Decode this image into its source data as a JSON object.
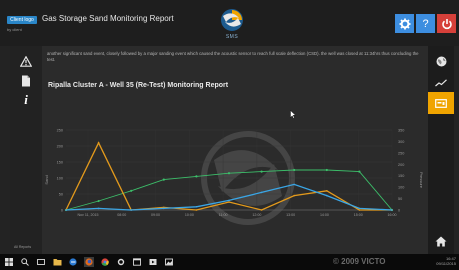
{
  "header": {
    "badge": "Client logo",
    "badge_sub": "by client",
    "title": "Gas Storage Sand Monitoring Report",
    "logo_text": "SMS",
    "help_label": "?"
  },
  "report": {
    "notes": "another significant sand event, closely followed by a major sanding event which caused the acoustic sensor to reach full scale deflection (CSD). the well was closed at 11:34hrs thus concluding the test.",
    "title": "Ripalla Cluster A - Well 35 (Re-Test) Monitoring Report"
  },
  "sidebar_left": {
    "info_label": "i",
    "footer": "All Reports"
  },
  "icons": [
    "warning-icon",
    "document-icon",
    "info-icon",
    "globe-icon",
    "trend-icon",
    "monitor-icon",
    "home-icon",
    "gear-icon",
    "help-icon",
    "power-icon"
  ],
  "colors": {
    "accent": "#3d8ee0",
    "power": "#d6403a",
    "active_tab": "#f0a400",
    "series_orange": "#e39a1c",
    "series_blue": "#3aa6e6",
    "series_green": "#3cbf6a"
  },
  "chart_data": {
    "type": "line",
    "ylabel": "Sand",
    "y2label": "Pressure",
    "yticks": [
      "250",
      "200",
      "150",
      "100",
      "50",
      "0"
    ],
    "y2ticks": [
      "350",
      "300",
      "250",
      "200",
      "150",
      "100",
      "50",
      "0"
    ],
    "xticks": [
      "Nov 11, 2015",
      "08:00",
      "09:00",
      "10:00",
      "11:00",
      "12:00",
      "13:00",
      "14:00",
      "15:00",
      "16:00"
    ],
    "grid": true,
    "series": [
      {
        "color": "#3cbf6a",
        "values": [
          0,
          28,
          60,
          95,
          105,
          115,
          120,
          125,
          125,
          120,
          0
        ]
      },
      {
        "color": "#e39a1c",
        "values": [
          0,
          210,
          0,
          8,
          0,
          25,
          0,
          45,
          60,
          0,
          0
        ]
      },
      {
        "color": "#3aa6e6",
        "values": [
          0,
          5,
          0,
          5,
          10,
          30,
          55,
          80,
          45,
          5,
          0
        ]
      }
    ]
  },
  "taskbar": {
    "watermark": "© 2009 VICTO",
    "time": "16:47",
    "date": "09/11/2015"
  }
}
